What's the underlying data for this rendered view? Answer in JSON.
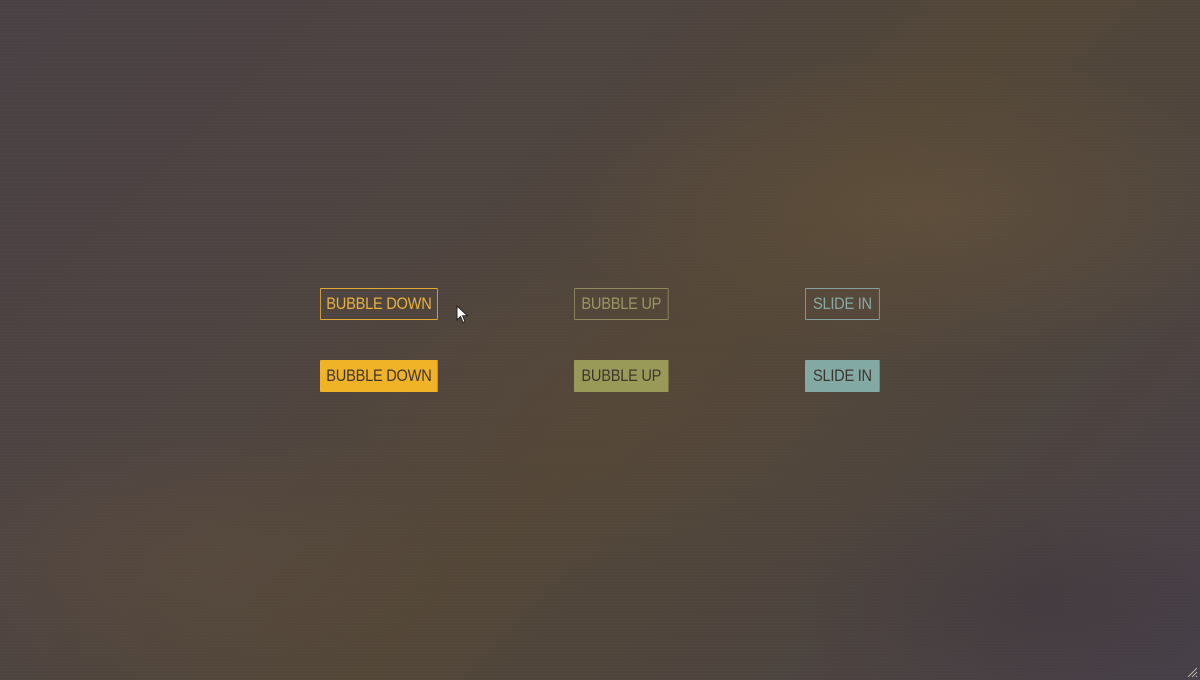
{
  "buttons": {
    "outline": [
      {
        "label": "BUBBLE DOWN",
        "color": "#e0aa35"
      },
      {
        "label": "BUBBLE UP",
        "color": "#8f8a56"
      },
      {
        "label": "SLIDE IN",
        "color": "#7fa29e"
      }
    ],
    "filled": [
      {
        "label": "BUBBLE DOWN",
        "color": "#f0b327"
      },
      {
        "label": "BUBBLE UP",
        "color": "#9a9a58"
      },
      {
        "label": "SLIDE IN",
        "color": "#83a9a4"
      }
    ]
  },
  "icons": {
    "cursor": "mouse-pointer-icon",
    "resize": "resize-grip-icon"
  },
  "colors": {
    "background": "#4d443f",
    "filled_text": "#3e3530"
  }
}
